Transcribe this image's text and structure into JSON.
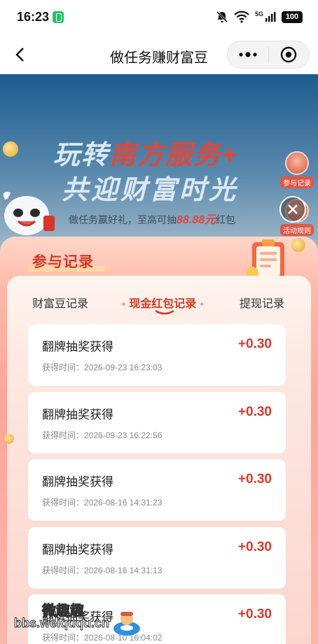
{
  "status_bar": {
    "time": "16:23",
    "network": "5G",
    "battery": "100"
  },
  "nav": {
    "title": "做任务赚财富豆"
  },
  "banner": {
    "title_prefix": "玩转",
    "title_highlight": "南方服务+",
    "title_line2": "共迎财富时光",
    "subtitle_prefix": "做任务赢好礼，至高可抽",
    "subtitle_amount": "88.88元",
    "subtitle_suffix": "红包",
    "side_join_label": "参与记录",
    "side_rules_label": "活动规则"
  },
  "modal": {
    "title": "参与记录",
    "tabs": [
      {
        "label": "财富豆记录",
        "active": false
      },
      {
        "label": "现金红包记录",
        "active": true
      },
      {
        "label": "提现记录",
        "active": false
      }
    ],
    "records": [
      {
        "title": "翻牌抽奖获得",
        "amount": "+0.30",
        "time": "获得时间：2026-09-23 16:23:03"
      },
      {
        "title": "翻牌抽奖获得",
        "amount": "+0.30",
        "time": "获得时间：2026-09-23 16:22:56"
      },
      {
        "title": "翻牌抽奖获得",
        "amount": "+0.30",
        "time": "获得时间：2026-08-16 14:31:23"
      },
      {
        "title": "翻牌抽奖获得",
        "amount": "+0.30",
        "time": "获得时间：2026-08-16 14:31:13"
      },
      {
        "title": "翻牌抽奖获得",
        "amount": "+0.30",
        "time": "获得时间：2026-08-10 16:04:02"
      }
    ]
  },
  "watermark": {
    "top": "微趣趣",
    "bottom": "bbs.weiququ.cn"
  },
  "colors": {
    "accent": "#d23a25",
    "amount": "#d9392b",
    "banner": "#1d5b8e"
  }
}
